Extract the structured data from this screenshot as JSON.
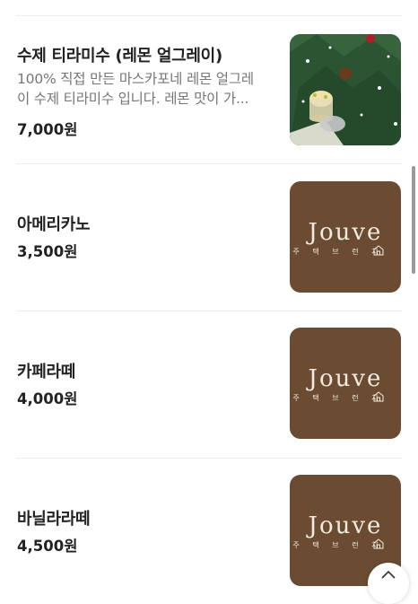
{
  "menu": {
    "items": [
      {
        "title": "수제 티라미수 (레몬 얼그레이)",
        "desc_line1": "100% 직접 만든 마스카포네 레몬 얼그레",
        "desc_line2": "이 수제 티라미수 입니다. 레몬 맛이 가...",
        "price": "7,000원",
        "image": "christmas-tree-tiramisu-photo"
      },
      {
        "title": "아메리카노",
        "price": "3,500원",
        "image": "jouve-logo"
      },
      {
        "title": "카페라떼",
        "price": "4,000원",
        "image": "jouve-logo"
      },
      {
        "title": "바닐라라떼",
        "price": "4,500원",
        "image": "jouve-logo"
      }
    ]
  },
  "logo": {
    "word": "Jouve",
    "sub": "주 택 브 런 치"
  },
  "colors": {
    "logo_bg": "#6b4c33",
    "logo_text": "#f3ebdf",
    "title": "#222222",
    "desc": "#767676",
    "divider": "#ececec"
  },
  "icons": {
    "fab": "chevron-up-icon",
    "logo_house": "house-icon"
  }
}
